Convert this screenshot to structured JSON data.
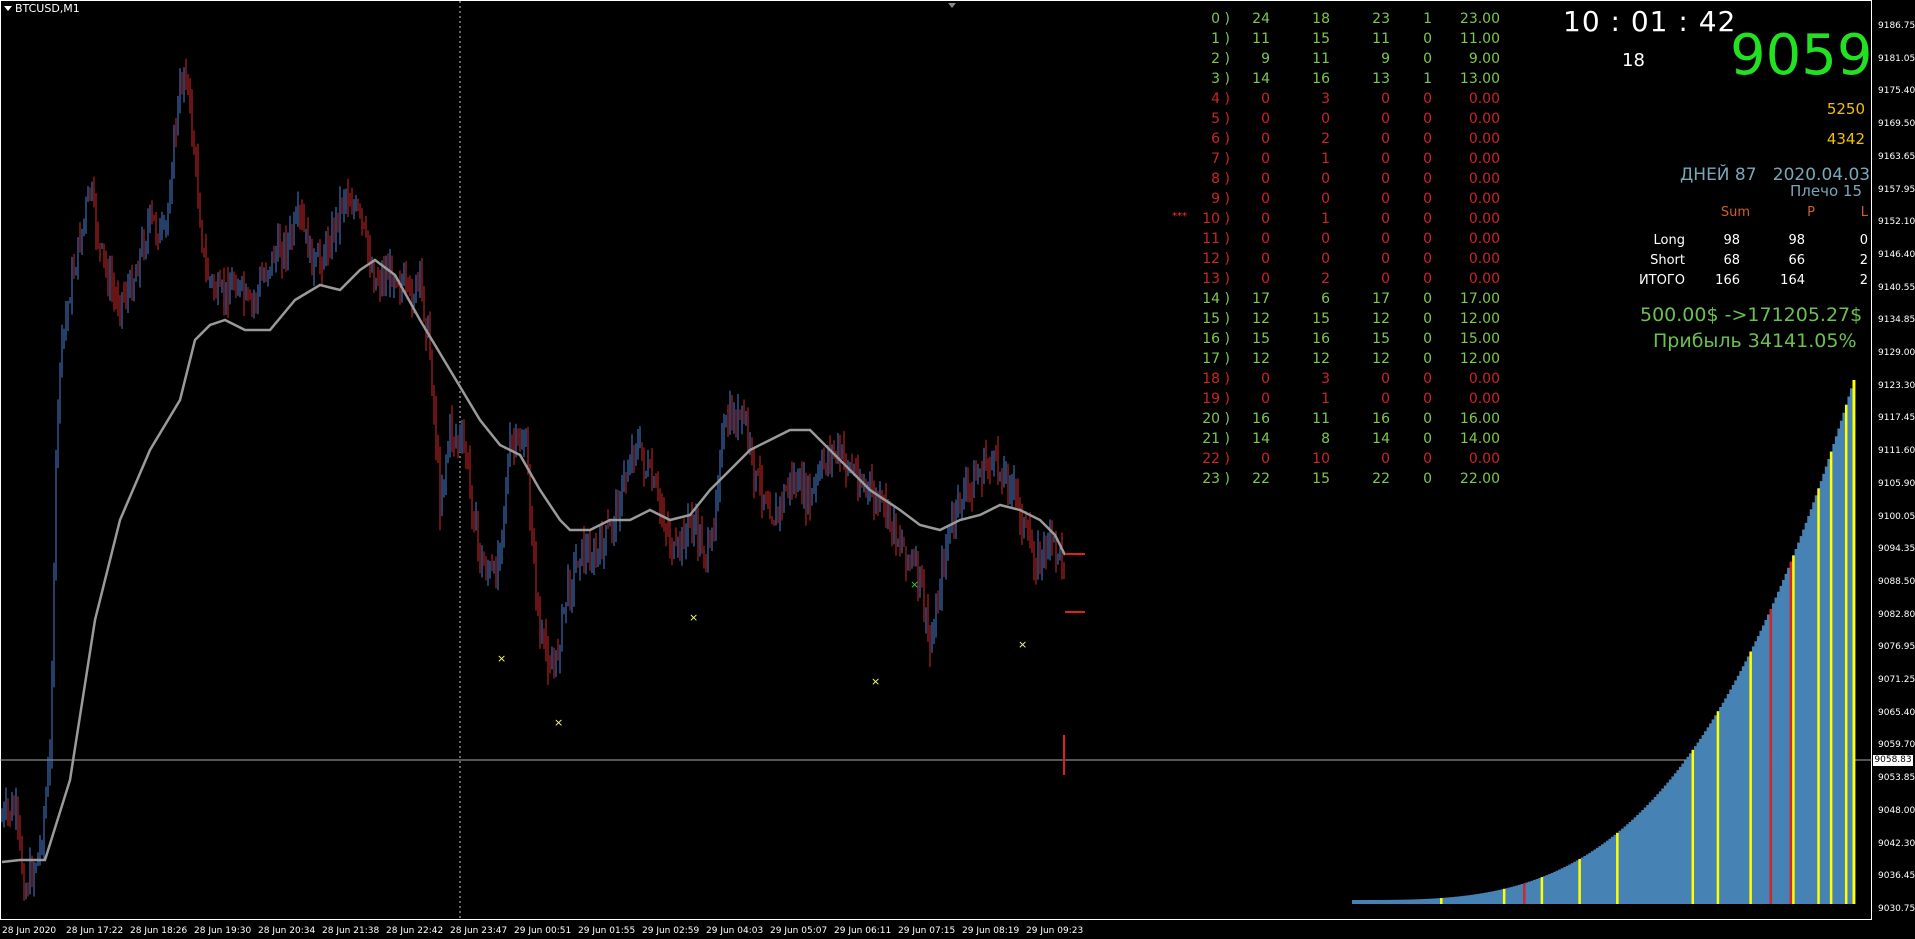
{
  "symbol_label": "BTCUSD,M1",
  "price_axis": {
    "ticks": [
      "9186.75",
      "9181.05",
      "9175.40",
      "9169.50",
      "9163.65",
      "9157.95",
      "9152.10",
      "9146.40",
      "9140.55",
      "9134.85",
      "9129.00",
      "9123.30",
      "9117.45",
      "9111.60",
      "9105.90",
      "9100.05",
      "9094.35",
      "9088.50",
      "9082.80",
      "9076.95",
      "9071.25",
      "9065.40",
      "9059.70",
      "9053.85",
      "9048.00",
      "9042.30",
      "9036.45",
      "9030.75"
    ],
    "current_price": "9058.83"
  },
  "time_axis": {
    "ticks": [
      "28 Jun 2020",
      "28 Jun 17:22",
      "28 Jun 18:26",
      "28 Jun 19:30",
      "28 Jun 20:34",
      "28 Jun 21:38",
      "28 Jun 22:42",
      "28 Jun 23:47",
      "29 Jun 00:51",
      "29 Jun 01:55",
      "29 Jun 02:59",
      "29 Jun 04:03",
      "29 Jun 05:07",
      "29 Jun 06:11",
      "29 Jun 07:15",
      "29 Jun 08:19",
      "29 Jun 09:23"
    ]
  },
  "hour_stats": [
    {
      "hour": "0 )",
      "a": "24",
      "b": "18",
      "c": "23",
      "d": "1",
      "e": "23.00",
      "color": "green",
      "mark": ""
    },
    {
      "hour": "1 )",
      "a": "11",
      "b": "15",
      "c": "11",
      "d": "0",
      "e": "11.00",
      "color": "green",
      "mark": ""
    },
    {
      "hour": "2 )",
      "a": "9",
      "b": "11",
      "c": "9",
      "d": "0",
      "e": "9.00",
      "color": "green",
      "mark": ""
    },
    {
      "hour": "3 )",
      "a": "14",
      "b": "16",
      "c": "13",
      "d": "1",
      "e": "13.00",
      "color": "green",
      "mark": ""
    },
    {
      "hour": "4 )",
      "a": "0",
      "b": "3",
      "c": "0",
      "d": "0",
      "e": "0.00",
      "color": "red",
      "mark": ""
    },
    {
      "hour": "5 )",
      "a": "0",
      "b": "0",
      "c": "0",
      "d": "0",
      "e": "0.00",
      "color": "red",
      "mark": ""
    },
    {
      "hour": "6 )",
      "a": "0",
      "b": "2",
      "c": "0",
      "d": "0",
      "e": "0.00",
      "color": "red",
      "mark": ""
    },
    {
      "hour": "7 )",
      "a": "0",
      "b": "1",
      "c": "0",
      "d": "0",
      "e": "0.00",
      "color": "red",
      "mark": ""
    },
    {
      "hour": "8 )",
      "a": "0",
      "b": "0",
      "c": "0",
      "d": "0",
      "e": "0.00",
      "color": "red",
      "mark": ""
    },
    {
      "hour": "9 )",
      "a": "0",
      "b": "0",
      "c": "0",
      "d": "0",
      "e": "0.00",
      "color": "red",
      "mark": ""
    },
    {
      "hour": "10 )",
      "a": "0",
      "b": "1",
      "c": "0",
      "d": "0",
      "e": "0.00",
      "color": "red",
      "mark": "***"
    },
    {
      "hour": "11 )",
      "a": "0",
      "b": "0",
      "c": "0",
      "d": "0",
      "e": "0.00",
      "color": "red",
      "mark": ""
    },
    {
      "hour": "12 )",
      "a": "0",
      "b": "0",
      "c": "0",
      "d": "0",
      "e": "0.00",
      "color": "red",
      "mark": ""
    },
    {
      "hour": "13 )",
      "a": "0",
      "b": "2",
      "c": "0",
      "d": "0",
      "e": "0.00",
      "color": "red",
      "mark": ""
    },
    {
      "hour": "14 )",
      "a": "17",
      "b": "6",
      "c": "17",
      "d": "0",
      "e": "17.00",
      "color": "green",
      "mark": ""
    },
    {
      "hour": "15 )",
      "a": "12",
      "b": "15",
      "c": "12",
      "d": "0",
      "e": "12.00",
      "color": "green",
      "mark": ""
    },
    {
      "hour": "16 )",
      "a": "15",
      "b": "16",
      "c": "15",
      "d": "0",
      "e": "15.00",
      "color": "green",
      "mark": ""
    },
    {
      "hour": "17 )",
      "a": "12",
      "b": "12",
      "c": "12",
      "d": "0",
      "e": "12.00",
      "color": "green",
      "mark": ""
    },
    {
      "hour": "18 )",
      "a": "0",
      "b": "3",
      "c": "0",
      "d": "0",
      "e": "0.00",
      "color": "red",
      "mark": ""
    },
    {
      "hour": "19 )",
      "a": "0",
      "b": "1",
      "c": "0",
      "d": "0",
      "e": "0.00",
      "color": "red",
      "mark": ""
    },
    {
      "hour": "20 )",
      "a": "16",
      "b": "11",
      "c": "16",
      "d": "0",
      "e": "16.00",
      "color": "green",
      "mark": ""
    },
    {
      "hour": "21 )",
      "a": "14",
      "b": "8",
      "c": "14",
      "d": "0",
      "e": "14.00",
      "color": "green",
      "mark": ""
    },
    {
      "hour": "22 )",
      "a": "0",
      "b": "10",
      "c": "0",
      "d": "0",
      "e": "0.00",
      "color": "red",
      "mark": ""
    },
    {
      "hour": "23 )",
      "a": "22",
      "b": "15",
      "c": "22",
      "d": "0",
      "e": "22.00",
      "color": "green",
      "mark": ""
    }
  ],
  "panel": {
    "clock": "10 : 01 : 42",
    "seconds_counter": "18",
    "big_price": "9059",
    "num1": "5250",
    "num2": "4342",
    "days_label": "ДНЕЙ 87",
    "date": "2020.04.03",
    "leverage": "Плечо  15",
    "summary_headers": [
      "Sum",
      "P",
      "L"
    ],
    "summary_rows": [
      {
        "label": "Long",
        "sum": "98",
        "p": "98",
        "l": "0"
      },
      {
        "label": "Short",
        "sum": "68",
        "p": "66",
        "l": "2"
      },
      {
        "label": "ИТОГО",
        "sum": "166",
        "p": "164",
        "l": "2"
      }
    ],
    "balance_line": "500.00$  ->171205.27$",
    "profit_line": "Прибыль   34141.05%"
  },
  "colors": {
    "bull": "#4a7fd0",
    "bear": "#d02828",
    "ma": "#9a9a9a",
    "equity_blue": "#4682b4",
    "equity_yellow": "#ffff00",
    "equity_red": "#d02828",
    "marker_yellow": "#ffff66",
    "marker_green": "#22e022"
  }
}
